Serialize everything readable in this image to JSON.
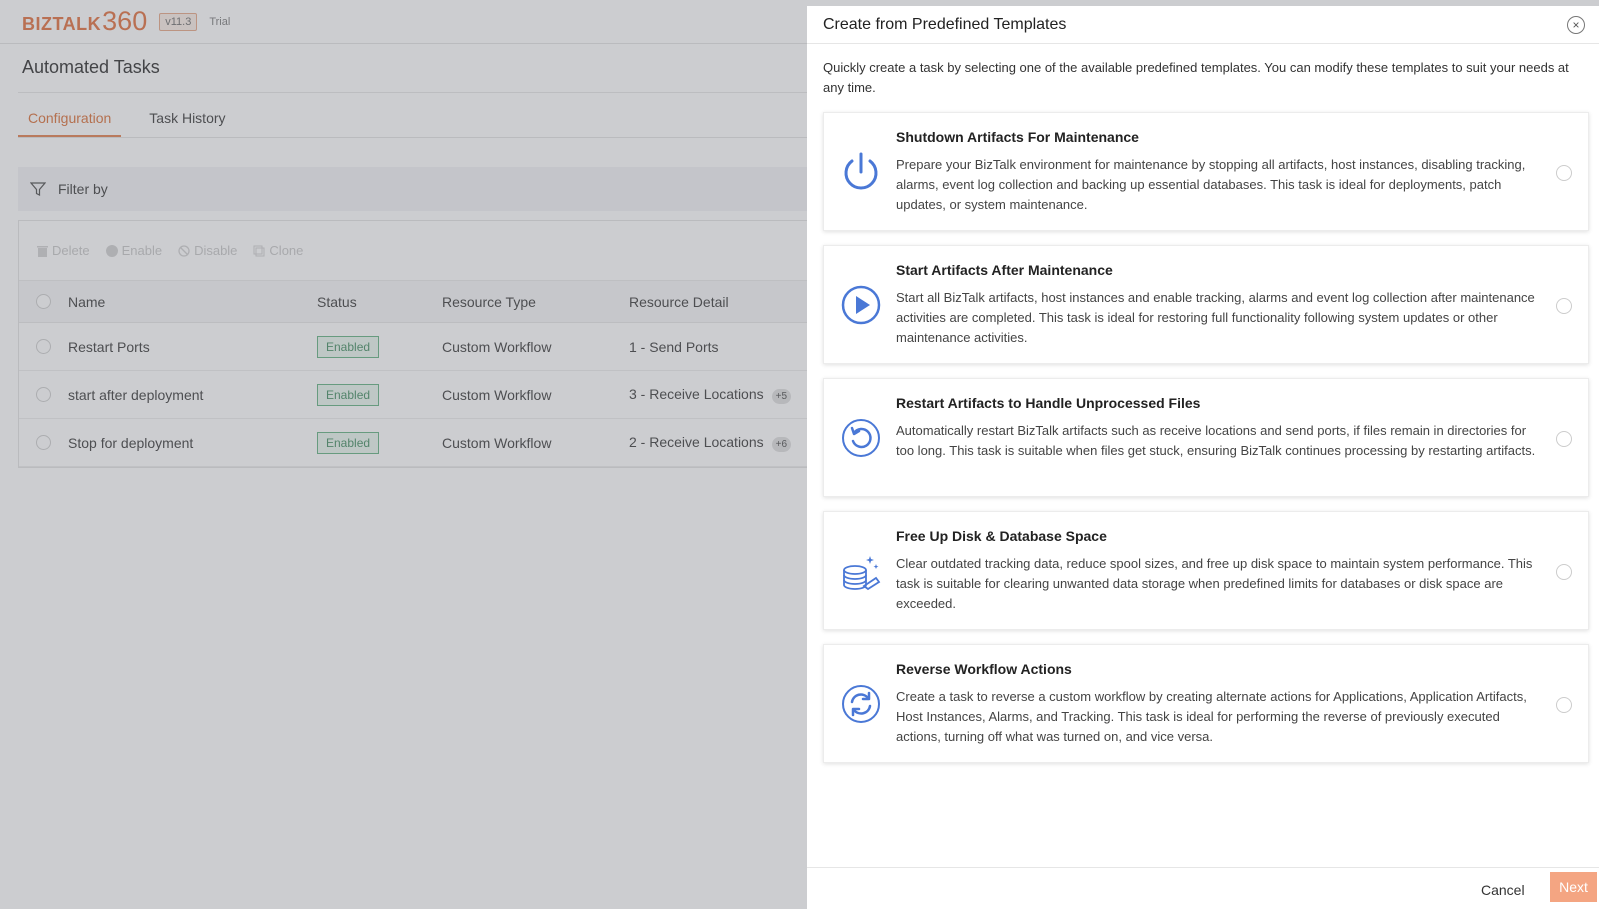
{
  "app": {
    "logo_biz": "BIZTALK",
    "logo_num": "360",
    "version": "v11.3",
    "trial": "Trial",
    "page_title": "Automated Tasks",
    "tabs": [
      {
        "label": "Configuration",
        "active": true
      },
      {
        "label": "Task History",
        "active": false
      }
    ],
    "filter_label": "Filter by",
    "actions": {
      "delete": "Delete",
      "enable": "Enable",
      "disable": "Disable",
      "clone": "Clone"
    },
    "columns": {
      "name": "Name",
      "status": "Status",
      "resource_type": "Resource Type",
      "resource_detail": "Resource Detail"
    },
    "rows": [
      {
        "name": "Restart Ports",
        "status": "Enabled",
        "resource_type": "Custom Workflow",
        "resource_detail": "1 - Send Ports",
        "more": ""
      },
      {
        "name": "start after deployment",
        "status": "Enabled",
        "resource_type": "Custom Workflow",
        "resource_detail": "3 - Receive Locations",
        "more": "+5"
      },
      {
        "name": "Stop for deployment",
        "status": "Enabled",
        "resource_type": "Custom Workflow",
        "resource_detail": "2 - Receive Locations",
        "more": "+6"
      }
    ]
  },
  "panel": {
    "title": "Create from Predefined Templates",
    "intro": "Quickly create a task by selecting one of the available predefined templates. You can modify these templates to suit your needs at any time.",
    "templates": [
      {
        "icon": "power-icon",
        "title": "Shutdown Artifacts For Maintenance",
        "description": "Prepare your BizTalk environment for maintenance by stopping all artifacts, host instances, disabling tracking, alarms, event log collection and backing up essential databases. This task is ideal for deployments, patch updates, or system maintenance."
      },
      {
        "icon": "play-icon",
        "title": "Start Artifacts After Maintenance",
        "description": "Start all BizTalk artifacts, host instances and enable tracking, alarms and event log collection after maintenance activities are completed. This task is ideal for restoring full functionality following system updates or other maintenance activities."
      },
      {
        "icon": "restart-icon",
        "title": "Restart Artifacts to Handle Unprocessed Files",
        "description": "Automatically restart BizTalk artifacts such as receive locations and send ports, if files remain in directories for too long. This task is suitable when files get stuck, ensuring BizTalk continues processing by restarting artifacts."
      },
      {
        "icon": "database-cleanup-icon",
        "title": "Free Up Disk & Database Space",
        "description": "Clear outdated tracking data, reduce spool sizes, and free up disk space to maintain system performance. This task is suitable for clearing unwanted data storage when predefined limits for databases or disk space are exceeded."
      },
      {
        "icon": "reverse-icon",
        "title": "Reverse Workflow Actions",
        "description": "Create a task to reverse a custom workflow by creating alternate actions for Applications, Application Artifacts, Host Instances, Alarms, and Tracking. This task is ideal for performing the reverse of previously executed actions, turning off what was turned on, and vice versa."
      }
    ],
    "cancel_label": "Cancel",
    "next_label": "Next"
  },
  "colors": {
    "accent": "#e06a36",
    "icon_blue": "#4a78d6",
    "enabled_green": "#3d8a5c",
    "next_disabled": "#f4a582"
  }
}
